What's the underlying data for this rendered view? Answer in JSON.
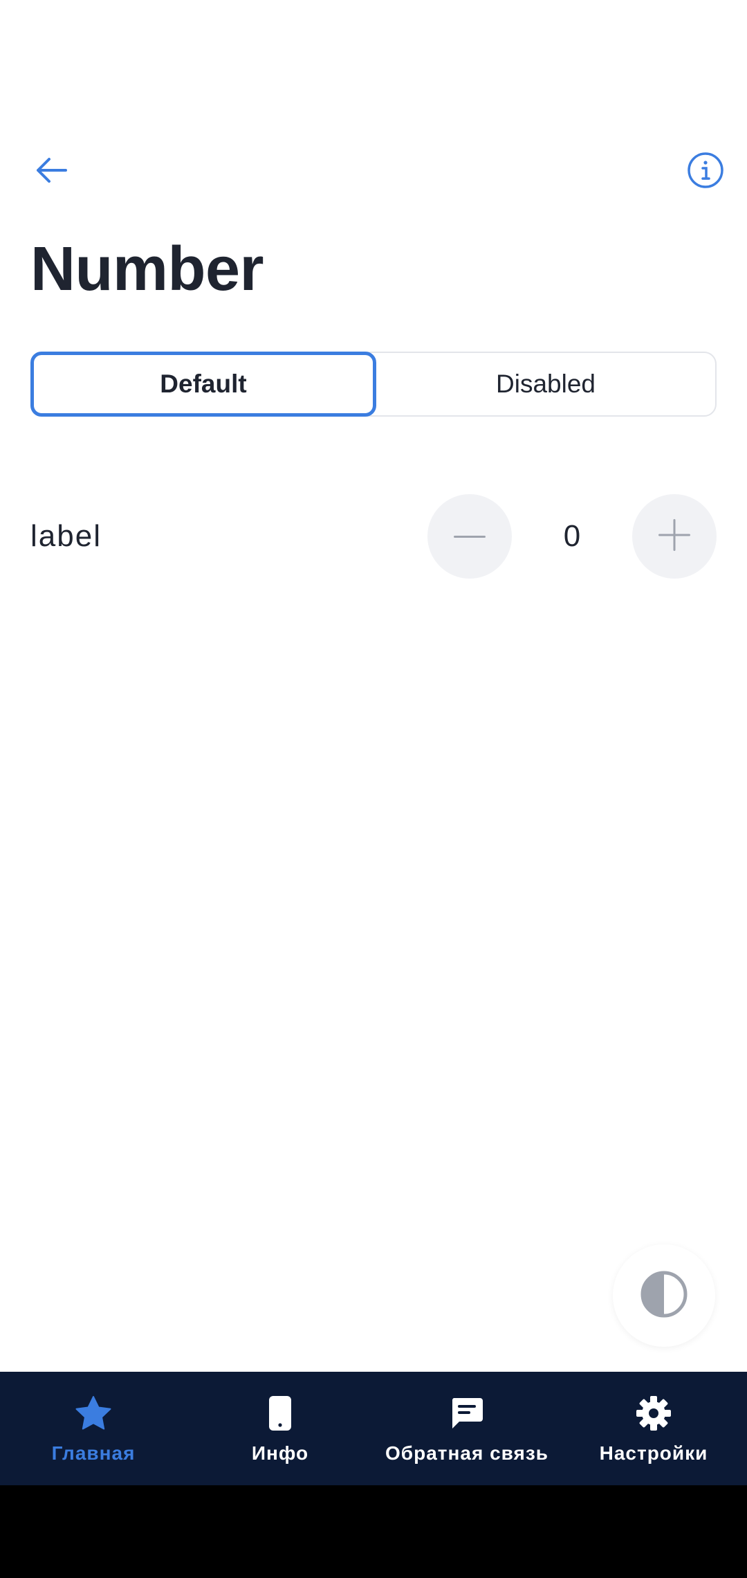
{
  "header": {
    "back_icon": "arrow-left-icon",
    "info_icon": "info-circle-icon",
    "title": "Number"
  },
  "segments": [
    {
      "label": "Default",
      "active": true
    },
    {
      "label": "Disabled",
      "active": false
    }
  ],
  "field": {
    "label": "label",
    "value": "0",
    "decrement_icon": "minus-icon",
    "increment_icon": "plus-icon"
  },
  "theme_toggle": {
    "icon": "half-circle-contrast-icon"
  },
  "bottom_nav": {
    "items": [
      {
        "label": "Главная",
        "icon": "star-icon",
        "active": true
      },
      {
        "label": "Инфо",
        "icon": "phone-icon",
        "active": false
      },
      {
        "label": "Обратная связь",
        "icon": "chat-icon",
        "active": false
      },
      {
        "label": "Настройки",
        "icon": "gear-icon",
        "active": false
      }
    ]
  },
  "colors": {
    "accent": "#3b7de0",
    "nav_background": "#0c1a36",
    "text": "#1f2430",
    "stepper_background": "#f1f2f5"
  }
}
